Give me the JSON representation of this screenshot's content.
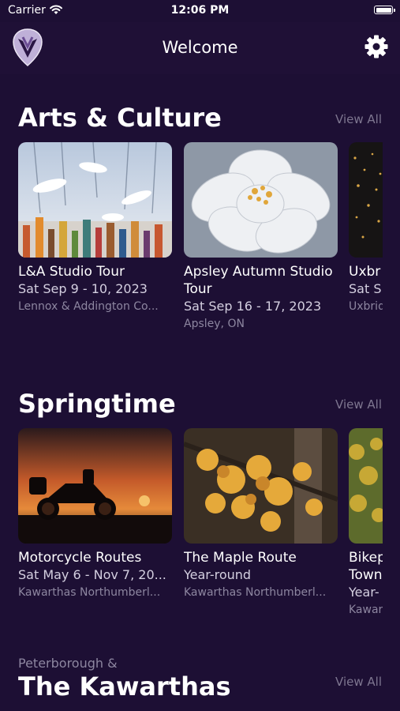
{
  "status_bar": {
    "carrier": "Carrier",
    "time": "12:06 PM"
  },
  "nav": {
    "title": "Welcome"
  },
  "sections": [
    {
      "title": "Arts & Culture",
      "view_all": "View All",
      "cards": [
        {
          "title": "L&A Studio Tour",
          "date": "Sat Sep 9 - 10, 2023",
          "location": "Lennox & Addington Co..."
        },
        {
          "title": "Apsley Autumn Studio Tour",
          "date": "Sat Sep 16 - 17, 2023",
          "location": "Apsley, ON"
        },
        {
          "title": "Uxbr",
          "date": "Sat S",
          "location": "Uxbrid"
        }
      ]
    },
    {
      "title": "Springtime",
      "view_all": "View All",
      "cards": [
        {
          "title": "Motorcycle Routes",
          "date": "Sat May 6 - Nov 7, 20...",
          "location": "Kawarthas Northumberl..."
        },
        {
          "title": "The Maple Route",
          "date": "Year-round",
          "location": "Kawarthas Northumberl..."
        },
        {
          "title": "Bikep Town",
          "date": "Year-",
          "location": "Kawar"
        }
      ]
    },
    {
      "kicker": "Peterborough &",
      "title": "The Kawarthas",
      "view_all": "View All"
    }
  ],
  "icons": {
    "logo": "shield-logo",
    "settings": "gear-icon",
    "wifi": "wifi-icon",
    "battery": "battery-icon"
  },
  "colors": {
    "background": "#1d0f34",
    "accent": "#8b6fb8",
    "muted": "#8d86a0"
  }
}
